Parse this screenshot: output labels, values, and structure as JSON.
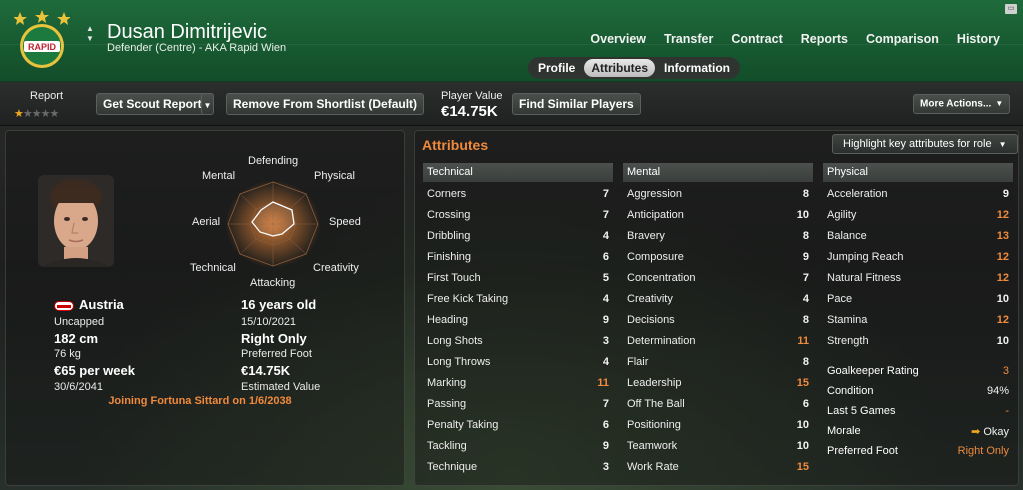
{
  "header": {
    "player_name": "Dusan Dimitrijevic",
    "player_sub": "Defender (Centre) - AKA Rapid Wien",
    "crest_text": "RAPID",
    "nav": [
      "Overview",
      "Transfer",
      "Contract",
      "Reports",
      "Comparison",
      "History"
    ],
    "subtabs": [
      "Profile",
      "Attributes",
      "Information"
    ],
    "active_subtab": "Attributes"
  },
  "toolbar": {
    "report_label": "Report",
    "report_stars": 1,
    "report_stars_max": 5,
    "get_scout_report": "Get Scout Report",
    "remove_shortlist": "Remove From Shortlist (Default)",
    "player_value_label": "Player Value",
    "player_value": "€14.75K",
    "find_similar": "Find Similar Players",
    "more_actions": "More Actions..."
  },
  "radar": {
    "labels": {
      "defending": "Defending",
      "physical": "Physical",
      "speed": "Speed",
      "creativity": "Creativity",
      "attacking": "Attacking",
      "technical": "Technical",
      "aerial": "Aerial",
      "mental": "Mental"
    }
  },
  "profile": {
    "nation": "Austria",
    "caps": "Uncapped",
    "height": "182 cm",
    "weight": "76 kg",
    "wage": "€65 per week",
    "contract_end": "30/6/2041",
    "age": "16 years old",
    "dob": "15/10/2021",
    "foot": "Right Only",
    "foot_label": "Preferred Foot",
    "value": "€14.75K",
    "value_label": "Estimated Value",
    "joining": "Joining Fortuna Sittard on 1/6/2038"
  },
  "attributes": {
    "title": "Attributes",
    "highlight_button": "Highlight key attributes for role",
    "technical": {
      "heading": "Technical",
      "rows": [
        {
          "name": "Corners",
          "value": "7"
        },
        {
          "name": "Crossing",
          "value": "7"
        },
        {
          "name": "Dribbling",
          "value": "4"
        },
        {
          "name": "Finishing",
          "value": "6"
        },
        {
          "name": "First Touch",
          "value": "5"
        },
        {
          "name": "Free Kick Taking",
          "value": "4"
        },
        {
          "name": "Heading",
          "value": "9"
        },
        {
          "name": "Long Shots",
          "value": "3"
        },
        {
          "name": "Long Throws",
          "value": "4"
        },
        {
          "name": "Marking",
          "value": "11"
        },
        {
          "name": "Passing",
          "value": "7"
        },
        {
          "name": "Penalty Taking",
          "value": "6"
        },
        {
          "name": "Tackling",
          "value": "9"
        },
        {
          "name": "Technique",
          "value": "3"
        }
      ]
    },
    "mental": {
      "heading": "Mental",
      "rows": [
        {
          "name": "Aggression",
          "value": "8"
        },
        {
          "name": "Anticipation",
          "value": "10"
        },
        {
          "name": "Bravery",
          "value": "8"
        },
        {
          "name": "Composure",
          "value": "9"
        },
        {
          "name": "Concentration",
          "value": "7"
        },
        {
          "name": "Creativity",
          "value": "4"
        },
        {
          "name": "Decisions",
          "value": "8"
        },
        {
          "name": "Determination",
          "value": "11"
        },
        {
          "name": "Flair",
          "value": "8"
        },
        {
          "name": "Leadership",
          "value": "15"
        },
        {
          "name": "Off The Ball",
          "value": "6"
        },
        {
          "name": "Positioning",
          "value": "10"
        },
        {
          "name": "Teamwork",
          "value": "10"
        },
        {
          "name": "Work Rate",
          "value": "15"
        }
      ]
    },
    "physical": {
      "heading": "Physical",
      "rows": [
        {
          "name": "Acceleration",
          "value": "9"
        },
        {
          "name": "Agility",
          "value": "12"
        },
        {
          "name": "Balance",
          "value": "13"
        },
        {
          "name": "Jumping Reach",
          "value": "12"
        },
        {
          "name": "Natural Fitness",
          "value": "12"
        },
        {
          "name": "Pace",
          "value": "10"
        },
        {
          "name": "Stamina",
          "value": "12"
        },
        {
          "name": "Strength",
          "value": "10"
        }
      ]
    },
    "extra": [
      {
        "name": "Goalkeeper Rating",
        "value": "3"
      },
      {
        "name": "Condition",
        "value": "94%"
      },
      {
        "name": "Last 5 Games",
        "value": "-"
      },
      {
        "name": "Morale",
        "value": "Okay"
      },
      {
        "name": "Preferred Foot",
        "value": "Right Only"
      }
    ]
  },
  "colors": {
    "accent": "#f08a3c",
    "header_green": "#1f6b3b",
    "high_value": "#f08a3c"
  }
}
